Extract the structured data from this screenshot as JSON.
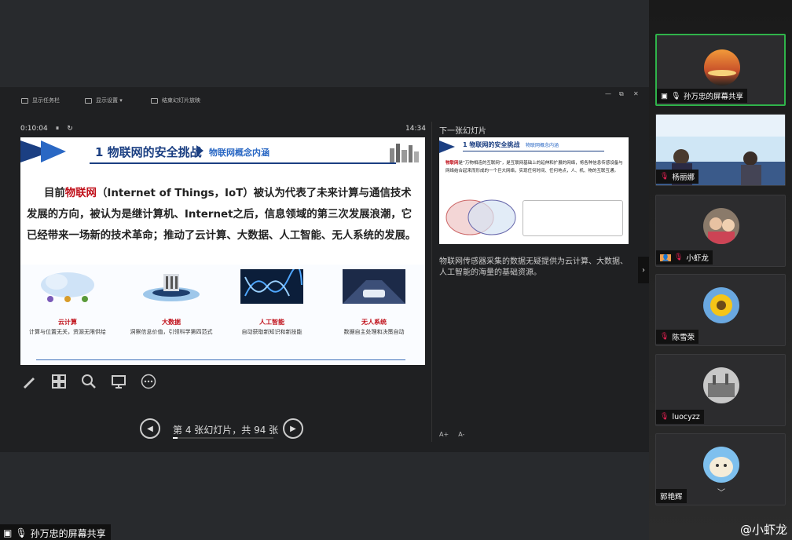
{
  "presenter": {
    "toolbar": [
      {
        "label": "显示任务栏"
      },
      {
        "label": "显示设置 ▾"
      },
      {
        "label": "结束幻灯片放映"
      }
    ],
    "window_controls": {
      "minimize": "—",
      "restore": "⧉",
      "close": "✕"
    },
    "timer": "0:10:04",
    "pause_icon": "⏸",
    "reset_icon": "↻",
    "clock": "14:34",
    "pagination": {
      "text": "第 4 张幻灯片，共 94 张",
      "prev": "◀",
      "next": "▶",
      "progress": 0.043
    },
    "next_slide_label": "下一张幻灯片",
    "notes": "物联网传感器采集的数据无疑提供为云计算、大数据、人工智能的海量的基础资源。",
    "font_buttons": [
      "A+",
      "A-"
    ],
    "side_toggle": "›"
  },
  "slide": {
    "title": "1 物联网的安全挑战",
    "subtitle": "物联网概念内涵",
    "body_prefix": "目前",
    "body_highlight": "物联网",
    "body_rest": "（Internet of Things，IoT）被认为代表了未来计算与通信技术发展的方向，被认为是继计算机、Internet之后，信息领域的第三次发展浪潮，它已经带来一场新的技术革命；推动了云计算、大数据、人工智能、无人系统的发展。",
    "cards": [
      {
        "title": "云计算",
        "desc": "计算与位置无关，资源无限供给"
      },
      {
        "title": "大数据",
        "desc": "洞察信息价值，引领科学第四范式"
      },
      {
        "title": "人工智能",
        "desc": "自动获取新知识和新技能"
      },
      {
        "title": "无人系统",
        "desc": "数据自主处理和决策自动"
      }
    ]
  },
  "next_slide": {
    "title": "1 物联网的安全挑战",
    "subtitle": "物联网概念内涵",
    "body_highlight": "物联网",
    "body": "是“万物相连的互联网”，是互联网基础上的延伸和扩展的网络，将各种信息传感设备与网络结合起来而形成的一个巨大网络，实现任何时间、任何地点，人、机、物的互联互通。"
  },
  "participants": [
    {
      "name": "孙万忠的屏幕共享",
      "active": true,
      "icon": "screen-share-icon"
    },
    {
      "name": "杨丽娜",
      "active": false
    },
    {
      "name": "小虾龙",
      "active": false
    },
    {
      "name": "陈雪荣",
      "active": false
    },
    {
      "name": "luocyzz",
      "active": false
    },
    {
      "name": "郭艳辉",
      "active": false
    }
  ],
  "bottom_share_label": "孙万忠的屏幕共享",
  "panel_scroll_up": "︿",
  "panel_scroll_down": "﹀",
  "watermark": "@小虾龙"
}
